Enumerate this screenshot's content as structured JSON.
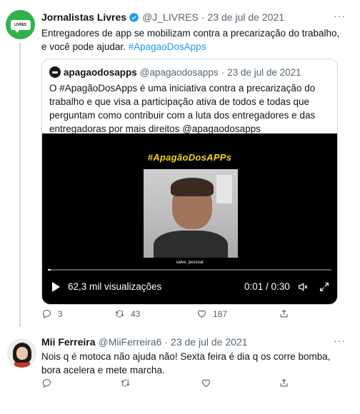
{
  "tweet1": {
    "display_name": "Jornalistas Livres",
    "handle": "@J_LIVRES",
    "separator": "·",
    "date": "23 de jul de 2021",
    "more": "···",
    "avatar_text": "LIVRES",
    "text": "Entregadores de app se mobilizam contra a precarização do trabalho, e você pode ajudar.",
    "hashtag": "#ApagaoDosApps",
    "quote": {
      "display_name": "apagaodosapps",
      "handle": "@apagaodosapps",
      "separator": "·",
      "date": "23 de jul de 2021",
      "text": "O #ApagãoDosApps é uma iniciativa contra a precarização do trabalho e que visa a participação ativa de todos e todas que perguntam como contribuir com a luta dos entregadores e das entregadoras por mais direitos @apagaodosapps",
      "video": {
        "overlay_title": "#ApagãoDosAPPs",
        "caption": "salve, pessoal",
        "views": "62,3 mil visualizações",
        "time": "0:01 / 0:30",
        "progress": 0.01
      }
    },
    "actions": {
      "replies": "3",
      "retweets": "43",
      "likes": "187"
    }
  },
  "tweet2": {
    "display_name": "Mii Ferreira",
    "handle": "@MiiFerreira6",
    "separator": "·",
    "date": "23 de jul de 2021",
    "more": "···",
    "text": "Nois q é motoca não ajuda não! Sexta feira é dia q os corre bomba, bora acelera e mete marcha."
  },
  "colors": {
    "accent": "#1d9bf0",
    "secondary_text": "#536471",
    "border": "#cfd9de",
    "video_title": "#f2d31b",
    "brand_green": "#2fb24a"
  }
}
